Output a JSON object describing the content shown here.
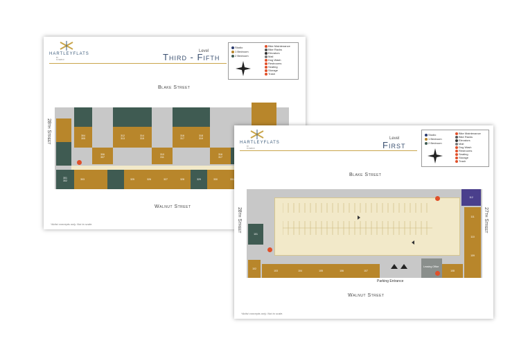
{
  "back_sheet": {
    "logo": {
      "word": "HARTLEYFLATS",
      "tagline": "BY FUSEBOX"
    },
    "level_label": "Level",
    "level_title": "Third - Fifth",
    "legend": {
      "units": [
        {
          "label": "Studio",
          "color": "#2b3b6e"
        },
        {
          "label": "1 Bedroom",
          "color": "#b8862b"
        },
        {
          "label": "2 Bedroom",
          "color": "#3f5b52"
        }
      ],
      "amenities": [
        "Bike Maintenance",
        "Bike Racks",
        "Elevators",
        "Mail",
        "Dog Wash",
        "Restrooms",
        "Seating",
        "Storage",
        "Trash"
      ]
    },
    "streets": {
      "top": "Blake Street",
      "bottom": "Walnut Street",
      "left": "28th Street"
    },
    "units_top": [
      "304\n305",
      "312\n313",
      "314\n315",
      "316\n317",
      "318\n319"
    ],
    "units_mid": [
      "306\n307",
      "310\n311",
      "316\n317",
      "320\n321",
      "322\n323"
    ],
    "units_bottom": [
      "301\n302",
      "303",
      "325",
      "326",
      "327",
      "328",
      "329",
      "330",
      "331"
    ],
    "footnote": "*Artist concepts only. Not to scale."
  },
  "front_sheet": {
    "logo": {
      "word": "HARTLEYFLATS",
      "tagline": "BY FUSEBOX"
    },
    "level_label": "Level",
    "level_title": "First",
    "legend": {
      "units": [
        {
          "label": "Studio",
          "color": "#2b3b6e"
        },
        {
          "label": "1 Bedroom",
          "color": "#b8862b"
        },
        {
          "label": "2 Bedroom",
          "color": "#3f5b52"
        }
      ],
      "amenities": [
        "Bike Maintenance",
        "Bike Racks",
        "Elevators",
        "Mail",
        "Dog Wash",
        "Restrooms",
        "Seating",
        "Storage",
        "Trash"
      ]
    },
    "streets": {
      "top": "Blake Street",
      "bottom": "Walnut Street",
      "left": "28th Street",
      "right": "27th Street"
    },
    "units_bottom": [
      "102",
      "103",
      "104",
      "105",
      "106",
      "107",
      "108"
    ],
    "units_right": [
      "112",
      "111",
      "110",
      "109"
    ],
    "unit_left": "101",
    "leasing_office": "Leasing Office",
    "parking_entrance": "Parking Entrance",
    "footnote": "*Artist concepts only. Not to scale."
  }
}
